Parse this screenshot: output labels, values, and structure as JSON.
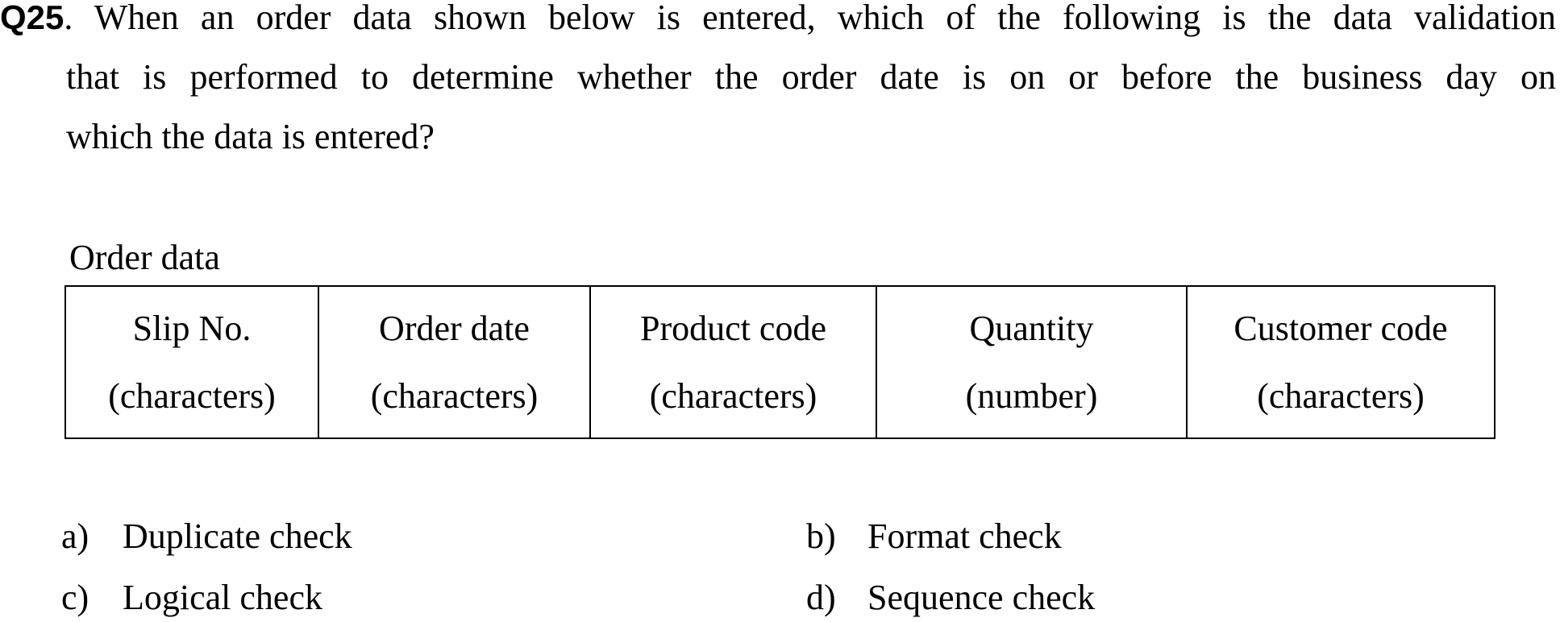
{
  "question": {
    "number": "Q25",
    "line1": ". When an order data shown below is entered, which of the following is the data validation",
    "line2": "that is performed to determine whether the order date is on or before the business day on",
    "line3": "which the data is entered?"
  },
  "table": {
    "caption": "Order data",
    "columns": [
      {
        "name": "Slip No.",
        "type": "(characters)"
      },
      {
        "name": "Order date",
        "type": "(characters)"
      },
      {
        "name": "Product code",
        "type": "(characters)"
      },
      {
        "name": "Quantity",
        "type": "(number)"
      },
      {
        "name": "Customer code",
        "type": "(characters)"
      }
    ]
  },
  "options": [
    {
      "letter": "a)",
      "text": "Duplicate check"
    },
    {
      "letter": "b)",
      "text": "Format check"
    },
    {
      "letter": "c)",
      "text": "Logical check"
    },
    {
      "letter": "d)",
      "text": "Sequence check"
    }
  ]
}
